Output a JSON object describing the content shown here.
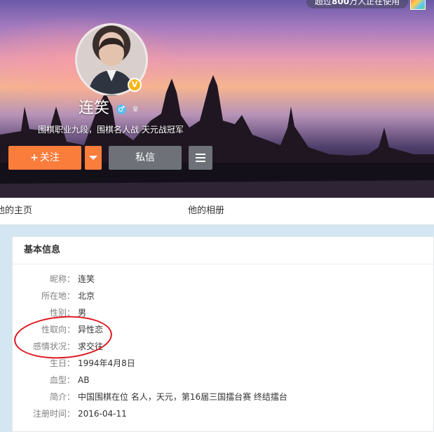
{
  "top_badge": {
    "prefix": "超过",
    "count": "800",
    "suffix": "万人正在使用"
  },
  "profile": {
    "name": "连笑",
    "description": "围棋职业九段，围棋名人战 天元战冠军",
    "verified_badge": "V"
  },
  "actions": {
    "follow": "关注",
    "message": "私信"
  },
  "tabs": {
    "home": "他的主页",
    "album": "他的相册"
  },
  "basic_info": {
    "title": "基本信息",
    "rows": [
      {
        "label": "昵称",
        "value": "连笑"
      },
      {
        "label": "所在地",
        "value": "北京"
      },
      {
        "label": "性别",
        "value": "男"
      },
      {
        "label": "性取向",
        "value": "异性恋"
      },
      {
        "label": "感情状况",
        "value": "求交往"
      },
      {
        "label": "生日",
        "value": "1994年4月8日"
      },
      {
        "label": "血型",
        "value": "AB"
      },
      {
        "label": "简介",
        "value": "中国围棋在位 名人，天元，第16届三国擂台赛 终结擂台"
      },
      {
        "label": "注册时间",
        "value": "2016-04-11"
      }
    ]
  },
  "colors": {
    "follow_button": "#fa7d3c",
    "secondary_button": "#6e7278",
    "highlight_ellipse": "#e0141c",
    "page_bg": "#d3e6f1"
  },
  "icons": [
    "male-icon",
    "crown-icon",
    "verified-icon",
    "caret-down-icon",
    "menu-icon",
    "app-icon"
  ]
}
